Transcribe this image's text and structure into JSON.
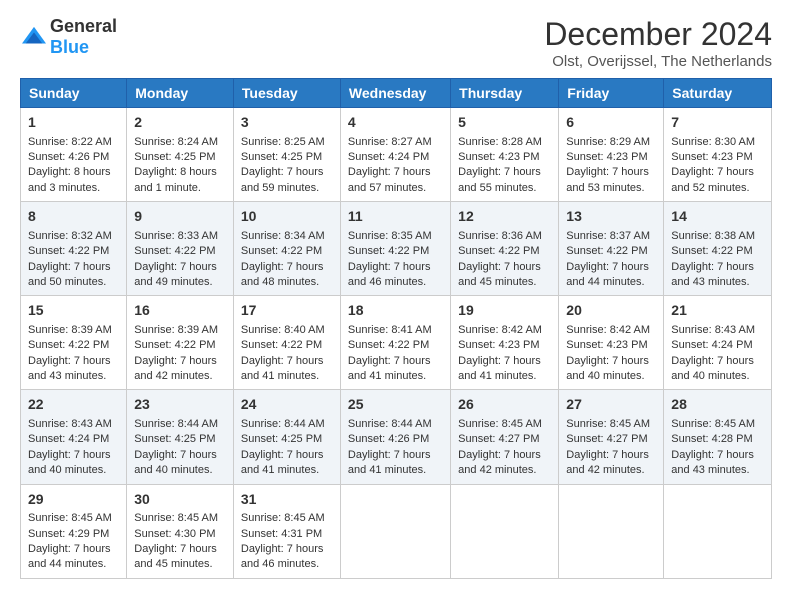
{
  "logo": {
    "general": "General",
    "blue": "Blue"
  },
  "title": "December 2024",
  "subtitle": "Olst, Overijssel, The Netherlands",
  "days_of_week": [
    "Sunday",
    "Monday",
    "Tuesday",
    "Wednesday",
    "Thursday",
    "Friday",
    "Saturday"
  ],
  "weeks": [
    [
      {
        "day": "1",
        "sunrise": "Sunrise: 8:22 AM",
        "sunset": "Sunset: 4:26 PM",
        "daylight": "Daylight: 8 hours and 3 minutes."
      },
      {
        "day": "2",
        "sunrise": "Sunrise: 8:24 AM",
        "sunset": "Sunset: 4:25 PM",
        "daylight": "Daylight: 8 hours and 1 minute."
      },
      {
        "day": "3",
        "sunrise": "Sunrise: 8:25 AM",
        "sunset": "Sunset: 4:25 PM",
        "daylight": "Daylight: 7 hours and 59 minutes."
      },
      {
        "day": "4",
        "sunrise": "Sunrise: 8:27 AM",
        "sunset": "Sunset: 4:24 PM",
        "daylight": "Daylight: 7 hours and 57 minutes."
      },
      {
        "day": "5",
        "sunrise": "Sunrise: 8:28 AM",
        "sunset": "Sunset: 4:23 PM",
        "daylight": "Daylight: 7 hours and 55 minutes."
      },
      {
        "day": "6",
        "sunrise": "Sunrise: 8:29 AM",
        "sunset": "Sunset: 4:23 PM",
        "daylight": "Daylight: 7 hours and 53 minutes."
      },
      {
        "day": "7",
        "sunrise": "Sunrise: 8:30 AM",
        "sunset": "Sunset: 4:23 PM",
        "daylight": "Daylight: 7 hours and 52 minutes."
      }
    ],
    [
      {
        "day": "8",
        "sunrise": "Sunrise: 8:32 AM",
        "sunset": "Sunset: 4:22 PM",
        "daylight": "Daylight: 7 hours and 50 minutes."
      },
      {
        "day": "9",
        "sunrise": "Sunrise: 8:33 AM",
        "sunset": "Sunset: 4:22 PM",
        "daylight": "Daylight: 7 hours and 49 minutes."
      },
      {
        "day": "10",
        "sunrise": "Sunrise: 8:34 AM",
        "sunset": "Sunset: 4:22 PM",
        "daylight": "Daylight: 7 hours and 48 minutes."
      },
      {
        "day": "11",
        "sunrise": "Sunrise: 8:35 AM",
        "sunset": "Sunset: 4:22 PM",
        "daylight": "Daylight: 7 hours and 46 minutes."
      },
      {
        "day": "12",
        "sunrise": "Sunrise: 8:36 AM",
        "sunset": "Sunset: 4:22 PM",
        "daylight": "Daylight: 7 hours and 45 minutes."
      },
      {
        "day": "13",
        "sunrise": "Sunrise: 8:37 AM",
        "sunset": "Sunset: 4:22 PM",
        "daylight": "Daylight: 7 hours and 44 minutes."
      },
      {
        "day": "14",
        "sunrise": "Sunrise: 8:38 AM",
        "sunset": "Sunset: 4:22 PM",
        "daylight": "Daylight: 7 hours and 43 minutes."
      }
    ],
    [
      {
        "day": "15",
        "sunrise": "Sunrise: 8:39 AM",
        "sunset": "Sunset: 4:22 PM",
        "daylight": "Daylight: 7 hours and 43 minutes."
      },
      {
        "day": "16",
        "sunrise": "Sunrise: 8:39 AM",
        "sunset": "Sunset: 4:22 PM",
        "daylight": "Daylight: 7 hours and 42 minutes."
      },
      {
        "day": "17",
        "sunrise": "Sunrise: 8:40 AM",
        "sunset": "Sunset: 4:22 PM",
        "daylight": "Daylight: 7 hours and 41 minutes."
      },
      {
        "day": "18",
        "sunrise": "Sunrise: 8:41 AM",
        "sunset": "Sunset: 4:22 PM",
        "daylight": "Daylight: 7 hours and 41 minutes."
      },
      {
        "day": "19",
        "sunrise": "Sunrise: 8:42 AM",
        "sunset": "Sunset: 4:23 PM",
        "daylight": "Daylight: 7 hours and 41 minutes."
      },
      {
        "day": "20",
        "sunrise": "Sunrise: 8:42 AM",
        "sunset": "Sunset: 4:23 PM",
        "daylight": "Daylight: 7 hours and 40 minutes."
      },
      {
        "day": "21",
        "sunrise": "Sunrise: 8:43 AM",
        "sunset": "Sunset: 4:24 PM",
        "daylight": "Daylight: 7 hours and 40 minutes."
      }
    ],
    [
      {
        "day": "22",
        "sunrise": "Sunrise: 8:43 AM",
        "sunset": "Sunset: 4:24 PM",
        "daylight": "Daylight: 7 hours and 40 minutes."
      },
      {
        "day": "23",
        "sunrise": "Sunrise: 8:44 AM",
        "sunset": "Sunset: 4:25 PM",
        "daylight": "Daylight: 7 hours and 40 minutes."
      },
      {
        "day": "24",
        "sunrise": "Sunrise: 8:44 AM",
        "sunset": "Sunset: 4:25 PM",
        "daylight": "Daylight: 7 hours and 41 minutes."
      },
      {
        "day": "25",
        "sunrise": "Sunrise: 8:44 AM",
        "sunset": "Sunset: 4:26 PM",
        "daylight": "Daylight: 7 hours and 41 minutes."
      },
      {
        "day": "26",
        "sunrise": "Sunrise: 8:45 AM",
        "sunset": "Sunset: 4:27 PM",
        "daylight": "Daylight: 7 hours and 42 minutes."
      },
      {
        "day": "27",
        "sunrise": "Sunrise: 8:45 AM",
        "sunset": "Sunset: 4:27 PM",
        "daylight": "Daylight: 7 hours and 42 minutes."
      },
      {
        "day": "28",
        "sunrise": "Sunrise: 8:45 AM",
        "sunset": "Sunset: 4:28 PM",
        "daylight": "Daylight: 7 hours and 43 minutes."
      }
    ],
    [
      {
        "day": "29",
        "sunrise": "Sunrise: 8:45 AM",
        "sunset": "Sunset: 4:29 PM",
        "daylight": "Daylight: 7 hours and 44 minutes."
      },
      {
        "day": "30",
        "sunrise": "Sunrise: 8:45 AM",
        "sunset": "Sunset: 4:30 PM",
        "daylight": "Daylight: 7 hours and 45 minutes."
      },
      {
        "day": "31",
        "sunrise": "Sunrise: 8:45 AM",
        "sunset": "Sunset: 4:31 PM",
        "daylight": "Daylight: 7 hours and 46 minutes."
      },
      {
        "day": "",
        "sunrise": "",
        "sunset": "",
        "daylight": ""
      },
      {
        "day": "",
        "sunrise": "",
        "sunset": "",
        "daylight": ""
      },
      {
        "day": "",
        "sunrise": "",
        "sunset": "",
        "daylight": ""
      },
      {
        "day": "",
        "sunrise": "",
        "sunset": "",
        "daylight": ""
      }
    ]
  ]
}
